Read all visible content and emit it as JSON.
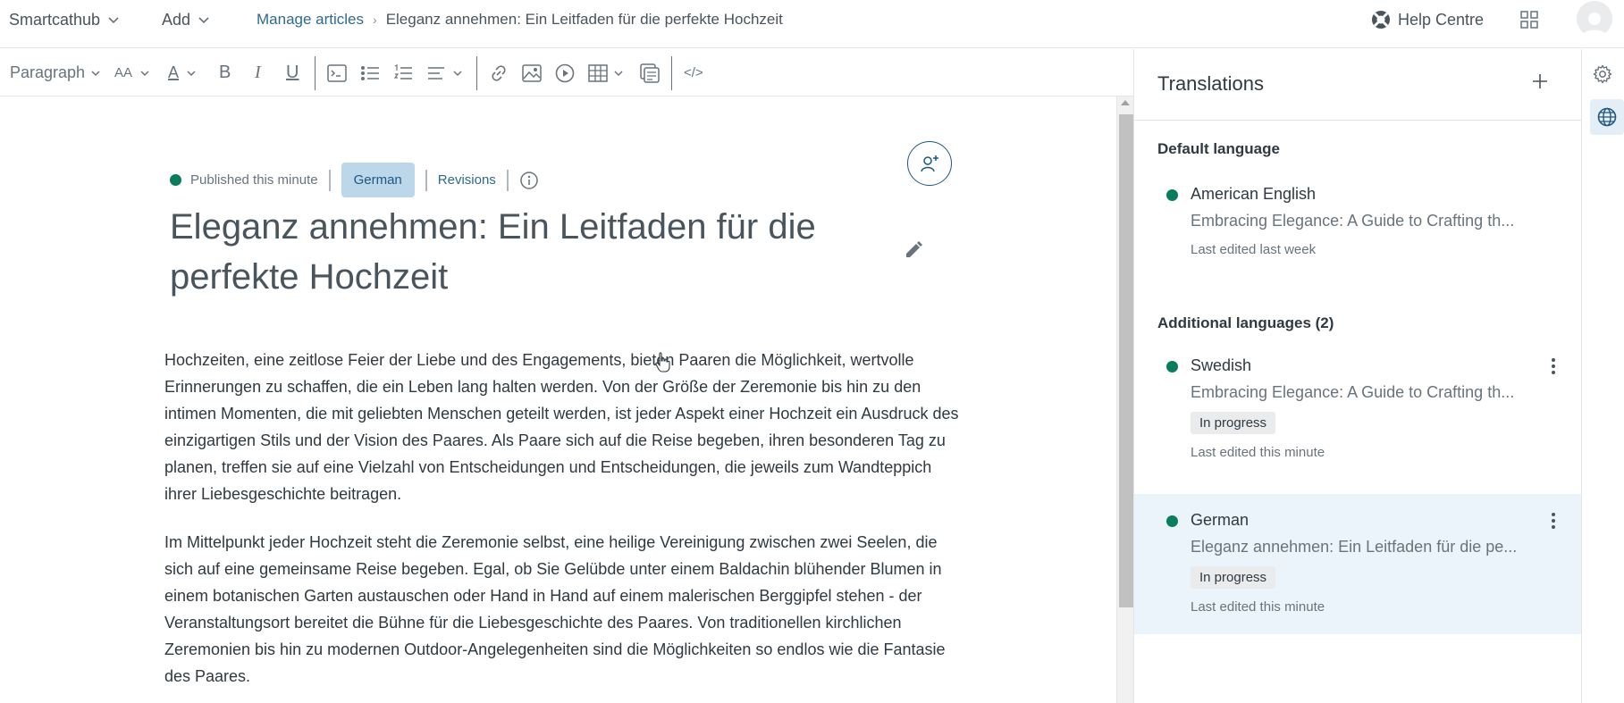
{
  "topbar": {
    "brand": "Smartcathub",
    "add_label": "Add",
    "breadcrumb_link": "Manage articles",
    "breadcrumb_current": "Eleganz annehmen: Ein Leitfaden für die perfekte Hochzeit",
    "help_label": "Help Centre"
  },
  "toolbar": {
    "paragraph_label": "Paragraph",
    "text_size_glyph": "AA",
    "font_color_glyph": "A",
    "bold_glyph": "B",
    "italic_glyph": "I",
    "underline_glyph": "U",
    "code_glyph": "</>"
  },
  "editor": {
    "status": "Published this minute",
    "language": "German",
    "revisions": "Revisions",
    "title": "Eleganz annehmen: Ein Leitfaden für die perfekte Hochzeit",
    "paragraphs": [
      "Hochzeiten, eine zeitlose Feier der Liebe und des Engagements, bieten Paaren die Möglichkeit, wertvolle Erinnerungen zu schaffen, die ein Leben lang halten werden. Von der Größe der Zeremonie bis hin zu den intimen Momenten, die mit geliebten Menschen geteilt werden, ist jeder Aspekt einer Hochzeit ein Ausdruck des einzigartigen Stils und der Vision des Paares. Als Paare sich auf die Reise begeben, ihren besonderen Tag zu planen, treffen sie auf eine Vielzahl von Entscheidungen und Entscheidungen, die jeweils zum Wandteppich ihrer Liebesgeschichte beitragen.",
      "Im Mittelpunkt jeder Hochzeit steht die Zeremonie selbst, eine heilige Vereinigung zwischen zwei Seelen, die sich auf eine gemeinsame Reise begeben. Egal, ob Sie Gelübde unter einem Baldachin blühender Blumen in einem botanischen Garten austauschen oder Hand in Hand auf einem malerischen Berggipfel stehen - der Veranstaltungsort bereitet die Bühne für die Liebesgeschichte des Paares. Von traditionellen kirchlichen Zeremonien bis hin zu modernen Outdoor-Angelegenheiten sind die Möglichkeiten so endlos wie die Fantasie des Paares."
    ]
  },
  "translations": {
    "title": "Translations",
    "default_label": "Default language",
    "additional_label": "Additional languages (2)",
    "default_item": {
      "name": "American English",
      "desc": "Embracing Elegance: A Guide to Crafting th...",
      "edited": "Last edited last week"
    },
    "items": [
      {
        "name": "Swedish",
        "desc": "Embracing Elegance: A Guide to Crafting th...",
        "badge": "In progress",
        "edited": "Last edited this minute"
      },
      {
        "name": "German",
        "desc": "Eleganz annehmen: Ein Leitfaden für die pe...",
        "badge": "In progress",
        "edited": "Last edited this minute"
      }
    ]
  },
  "colors": {
    "published_dot": "#0a7d5e",
    "link": "#2f6a8f",
    "active_row": "#ebf4fb"
  }
}
